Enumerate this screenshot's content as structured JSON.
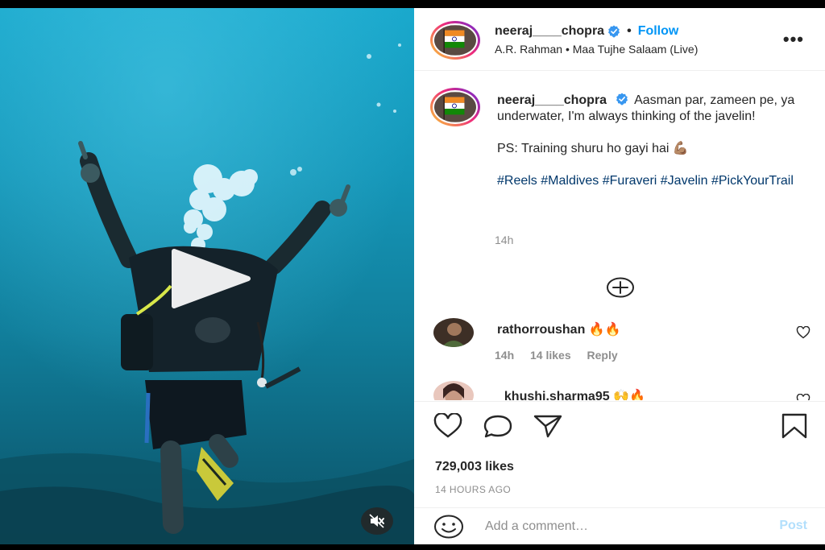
{
  "post": {
    "author": {
      "username": "neeraj____chopra",
      "verified": true,
      "follow_label": "Follow",
      "separator": "•"
    },
    "audio": {
      "artist": "A.R. Rahman",
      "separator": "•",
      "track": "Maa Tujhe Salaam (Live)"
    },
    "more_icon": "more-options-icon",
    "more_glyph": "•••"
  },
  "media": {
    "type": "video",
    "play_icon": "play-icon",
    "mute_icon": "muted-speaker-icon",
    "water_color_top": "#1aa9cd",
    "water_color_bottom": "#0b5468"
  },
  "caption": {
    "username": "neeraj____chopra",
    "line1": "Aasman par, zameen pe, ya underwater, I'm always thinking of the javelin!",
    "line2": "PS: Training shuru ho gayi hai 💪🏽",
    "hashtags": [
      "#Reels",
      "#Maldives",
      "#Furaveri",
      "#Javelin",
      "#PickYourTrail"
    ],
    "time": "14h"
  },
  "load_more_icon": "plus-circle-icon",
  "comments": [
    {
      "username": "rathorroushan",
      "text": "🔥🔥",
      "time": "14h",
      "likes": "14 likes",
      "reply_label": "Reply"
    },
    {
      "username": "_khushi.sharma95",
      "text": "🙌🔥"
    }
  ],
  "actions": {
    "icons": [
      "heart-icon",
      "comment-icon",
      "share-icon",
      "save-icon"
    ],
    "likes_count": "729,003 likes",
    "time_ago": "14 HOURS AGO"
  },
  "comment_box": {
    "placeholder": "Add a comment…",
    "post_label": "Post",
    "emoji_icon": "smiley-icon"
  },
  "colors": {
    "link_blue": "#0095f6",
    "hashtag_blue": "#00376b",
    "muted_gray": "#8e8e8e",
    "post_disabled": "#b2dffc",
    "verified_blue": "#3897f0"
  }
}
